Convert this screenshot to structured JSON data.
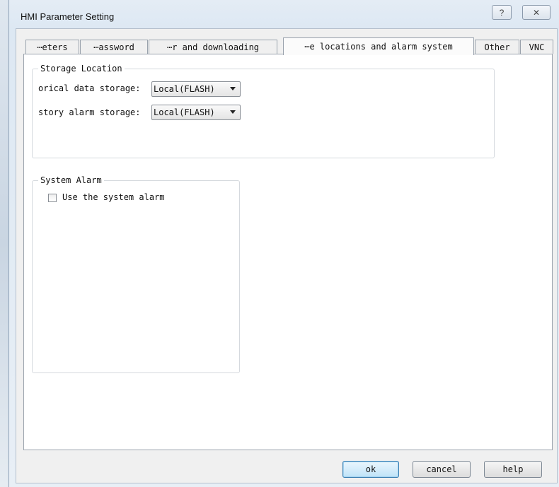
{
  "window": {
    "title": "HMI Parameter Setting",
    "help_glyph": "?",
    "close_glyph": "✕"
  },
  "tabs": [
    {
      "label": "⋯eters"
    },
    {
      "label": "⋯assword"
    },
    {
      "label": "⋯r and downloading"
    },
    {
      "label": "⋯e locations and alarm system",
      "active": true
    },
    {
      "label": "Other"
    },
    {
      "label": "VNC"
    }
  ],
  "storage": {
    "group_title": "Storage Location",
    "historical_label": "orical data storage:",
    "historical_value": "Local(FLASH)",
    "alarm_label": "story alarm storage:",
    "alarm_value": "Local(FLASH)"
  },
  "system_alarm": {
    "group_title": "System Alarm",
    "checkbox_label": "Use the system alarm",
    "checked": false
  },
  "buttons": {
    "ok": "ok",
    "cancel": "cancel",
    "help": "help"
  }
}
